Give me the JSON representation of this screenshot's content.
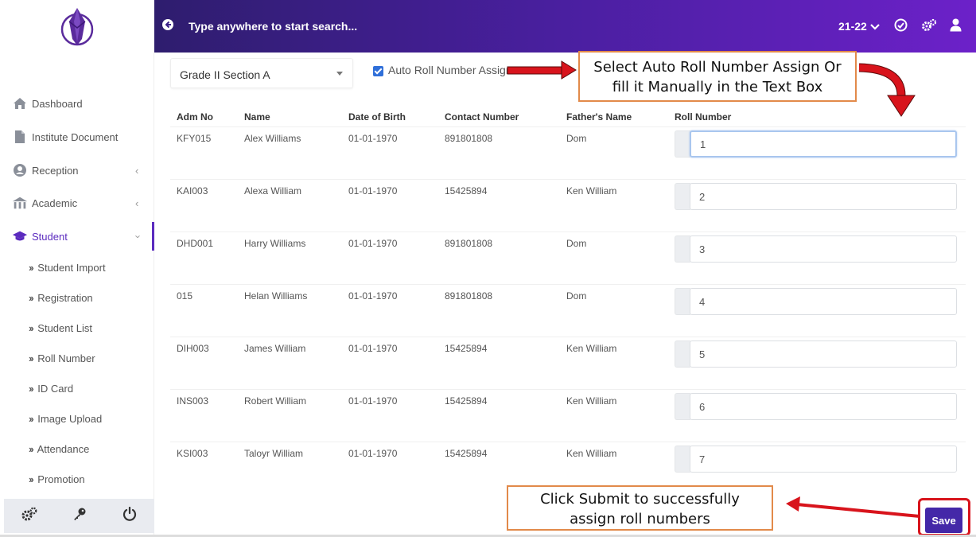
{
  "header": {
    "search_placeholder": "Type anywhere to start search...",
    "session": "21-22"
  },
  "sidebar": {
    "items": [
      {
        "label": "Dashboard",
        "icon": "home-icon"
      },
      {
        "label": "Institute Document",
        "icon": "document-icon"
      },
      {
        "label": "Reception",
        "icon": "user-circle-icon"
      },
      {
        "label": "Academic",
        "icon": "building-icon"
      },
      {
        "label": "Student",
        "icon": "graduation-cap-icon"
      }
    ],
    "student_sub": [
      "Student Import",
      "Registration",
      "Student List",
      "Roll Number",
      "ID Card",
      "Image Upload",
      "Attendance",
      "Promotion"
    ]
  },
  "filters": {
    "class_section": "Grade II Section A",
    "auto_roll_label": "Auto Roll Number Assign",
    "auto_roll_checked": true
  },
  "table": {
    "headers": [
      "Adm No",
      "Name",
      "Date of Birth",
      "Contact Number",
      "Father's Name",
      "Roll Number"
    ],
    "rows": [
      {
        "adm": "KFY015",
        "name": "Alex Williams",
        "dob": "01-01-1970",
        "contact": "891801808",
        "father": "Dom",
        "roll": "1"
      },
      {
        "adm": "KAI003",
        "name": "Alexa William",
        "dob": "01-01-1970",
        "contact": "15425894",
        "father": "Ken William",
        "roll": "2"
      },
      {
        "adm": "DHD001",
        "name": "Harry Williams",
        "dob": "01-01-1970",
        "contact": "891801808",
        "father": "Dom",
        "roll": "3"
      },
      {
        "adm": "015",
        "name": "Helan Williams",
        "dob": "01-01-1970",
        "contact": "891801808",
        "father": "Dom",
        "roll": "4"
      },
      {
        "adm": "DIH003",
        "name": "James William",
        "dob": "01-01-1970",
        "contact": "15425894",
        "father": "Ken William",
        "roll": "5"
      },
      {
        "adm": "INS003",
        "name": "Robert William",
        "dob": "01-01-1970",
        "contact": "15425894",
        "father": "Ken William",
        "roll": "6"
      },
      {
        "adm": "KSI003",
        "name": "Taloyr William",
        "dob": "01-01-1970",
        "contact": "15425894",
        "father": "Ken William",
        "roll": "7"
      }
    ]
  },
  "actions": {
    "save_label": "Save"
  },
  "annotations": {
    "auto_roll_note_line1": "Select Auto Roll Number Assign Or",
    "auto_roll_note_line2": "fill it Manually in the Text Box",
    "submit_note_line1": "Click Submit to successfully",
    "submit_note_line2": "assign roll numbers"
  },
  "colors": {
    "header_gradient_start": "#2e1d6e",
    "header_gradient_end": "#6c21c9",
    "accent": "#5b2bbf",
    "save_button": "#4428a8",
    "annotation_arrow": "#d8141c",
    "callout_border": "#e28a4a"
  }
}
